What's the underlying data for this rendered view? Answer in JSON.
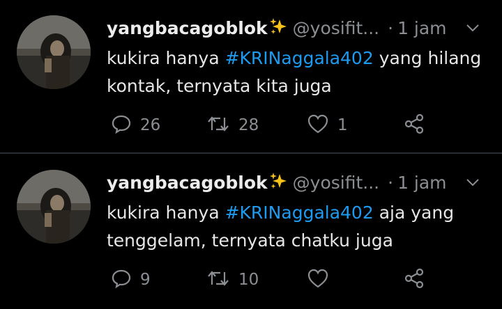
{
  "tweets": [
    {
      "display_name": "yangbacagoblok",
      "handle": "@yosifit...",
      "separator": "·",
      "time": "1 jam",
      "text_before": "kukira hanya ",
      "hashtag": "#KRINaggala402",
      "text_after": " yang hilang kontak, ternyata kita juga",
      "replies": "26",
      "retweets": "28",
      "likes": "1"
    },
    {
      "display_name": "yangbacagoblok",
      "handle": "@yosifit...",
      "separator": "·",
      "time": "1 jam",
      "text_before": "kukira hanya ",
      "hashtag": "#KRINaggala402",
      "text_after": " aja yang tenggelam, ternyata chatku juga",
      "replies": "9",
      "retweets": "10",
      "likes": ""
    }
  ],
  "colors": {
    "background": "#000000",
    "hashtag": "#1d9bf0",
    "muted": "#8b8e92",
    "sparkle": "#f5c21b"
  },
  "icons": [
    "reply-icon",
    "retweet-icon",
    "like-icon",
    "share-icon",
    "chevron-down-icon",
    "sparkles-icon"
  ]
}
